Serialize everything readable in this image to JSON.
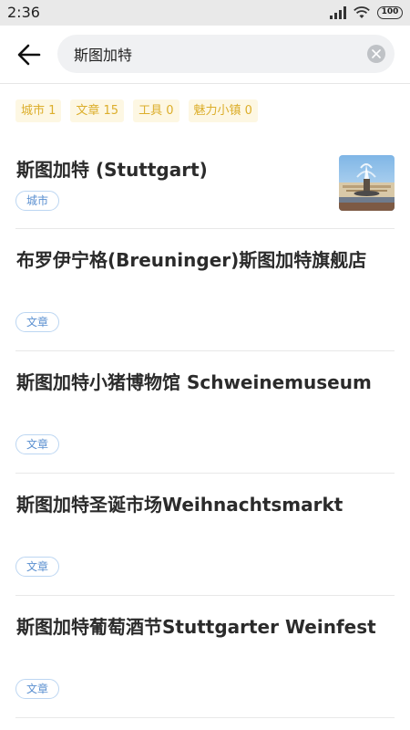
{
  "status_bar": {
    "time": "2:36",
    "battery": "100",
    "icons": [
      "signal-icon",
      "wifi-icon",
      "battery-icon"
    ]
  },
  "search": {
    "query": "斯图加特",
    "back_icon": "arrow-left-icon",
    "clear_icon": "clear-x-icon"
  },
  "filters": [
    {
      "label": "城市 1"
    },
    {
      "label": "文章 15"
    },
    {
      "label": "工具 0"
    },
    {
      "label": "魅力小镇 0"
    }
  ],
  "results": [
    {
      "title": "斯图加特 (Stuttgart)",
      "badge": "城市",
      "has_thumbnail": true
    },
    {
      "title": "布罗伊宁格(Breuninger)斯图加特旗舰店",
      "badge": "文章"
    },
    {
      "title": "斯图加特小猪博物馆 Schweinemuseum",
      "badge": "文章"
    },
    {
      "title": "斯图加特圣诞市场Weihnachtsmarkt",
      "badge": "文章"
    },
    {
      "title": "斯图加特葡萄酒节Stuttgarter Weinfest",
      "badge": "文章"
    }
  ],
  "colors": {
    "filter_text": "#dcae2b",
    "filter_bg": "#fdf7e3",
    "badge_text": "#5a8fd0",
    "badge_border": "#bcd6f2",
    "search_bg": "#f0f1f3"
  }
}
